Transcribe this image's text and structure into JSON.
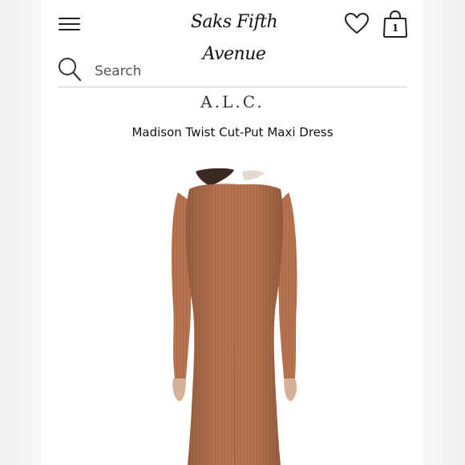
{
  "header": {
    "logo_text": "Saks Fifth Avenue",
    "bag_count": "1",
    "icons": {
      "menu": "hamburger-menu-icon",
      "wishlist": "heart-icon",
      "bag": "shopping-bag-icon",
      "search": "search-icon"
    }
  },
  "search": {
    "placeholder": "Search",
    "value": ""
  },
  "product": {
    "brand": "A.L.C.",
    "title": "Madison Twist Cut-Put Maxi Dress",
    "dress_color": "#b8744f"
  }
}
